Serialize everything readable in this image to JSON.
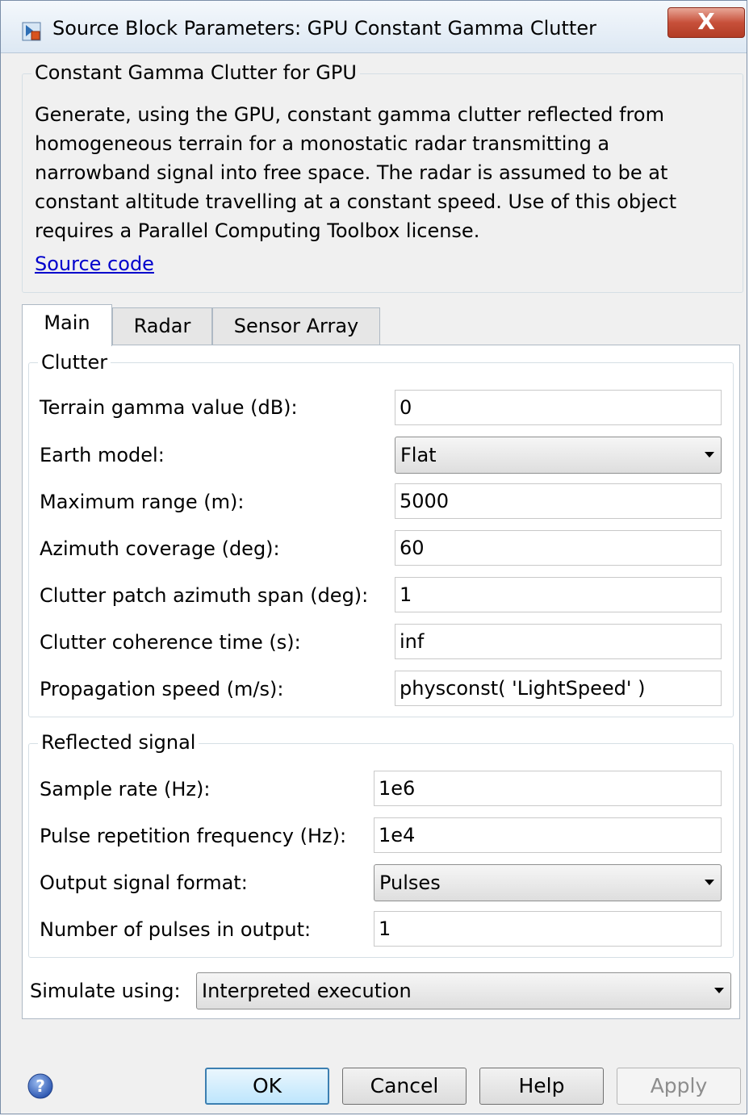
{
  "window": {
    "title": "Source Block Parameters: GPU Constant Gamma Clutter",
    "close_label": "X"
  },
  "block": {
    "group_title": "Constant Gamma Clutter for GPU",
    "description": "Generate, using the GPU, constant gamma clutter reflected from homogeneous terrain for a monostatic radar transmitting a narrowband signal into free space. The radar is assumed to be at constant altitude travelling at a constant speed. Use of this object requires a Parallel Computing Toolbox license.",
    "source_link": "Source code"
  },
  "tabs": [
    {
      "label": "Main",
      "active": true
    },
    {
      "label": "Radar",
      "active": false
    },
    {
      "label": "Sensor Array",
      "active": false
    }
  ],
  "clutter": {
    "title": "Clutter",
    "fields": [
      {
        "label": "Terrain gamma value (dB):",
        "value": "0",
        "type": "edit"
      },
      {
        "label": "Earth model:",
        "value": "Flat",
        "type": "popup"
      },
      {
        "label": "Maximum range (m):",
        "value": "5000",
        "type": "edit"
      },
      {
        "label": "Azimuth coverage (deg):",
        "value": "60",
        "type": "edit"
      },
      {
        "label": "Clutter patch azimuth span (deg):",
        "value": "1",
        "type": "edit"
      },
      {
        "label": "Clutter coherence time (s):",
        "value": "inf",
        "type": "edit"
      },
      {
        "label": "Propagation speed (m/s):",
        "value": "physconst( 'LightSpeed' )",
        "type": "edit"
      }
    ]
  },
  "reflected": {
    "title": "Reflected signal",
    "fields": [
      {
        "label": "Sample rate (Hz):",
        "value": "1e6",
        "type": "edit"
      },
      {
        "label": "Pulse repetition frequency (Hz):",
        "value": "1e4",
        "type": "edit"
      },
      {
        "label": "Output signal format:",
        "value": "Pulses",
        "type": "popup"
      },
      {
        "label": "Number of pulses in output:",
        "value": "1",
        "type": "edit"
      }
    ]
  },
  "simulate": {
    "label": "Simulate using:",
    "value": "Interpreted execution"
  },
  "buttons": {
    "ok": "OK",
    "cancel": "Cancel",
    "help": "Help",
    "apply": "Apply"
  },
  "colors": {
    "link": "#0000cc",
    "default_button_border": "#3c7fb1",
    "close_button": "#c7503a"
  },
  "icons": [
    "simulink-block-icon",
    "close-icon",
    "help-icon",
    "dropdown-caret-icon"
  ]
}
